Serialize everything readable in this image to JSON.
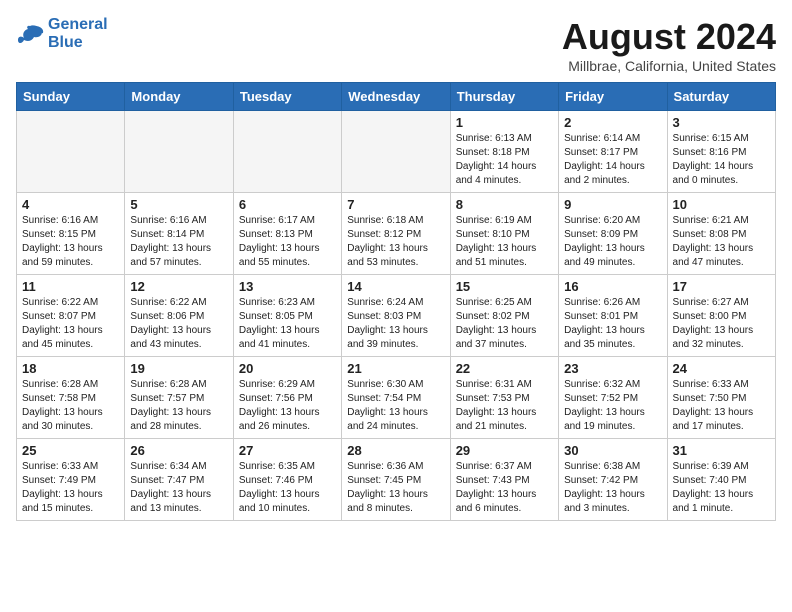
{
  "header": {
    "logo_line1": "General",
    "logo_line2": "Blue",
    "month_title": "August 2024",
    "location": "Millbrae, California, United States"
  },
  "weekdays": [
    "Sunday",
    "Monday",
    "Tuesday",
    "Wednesday",
    "Thursday",
    "Friday",
    "Saturday"
  ],
  "weeks": [
    [
      {
        "day": "",
        "info": ""
      },
      {
        "day": "",
        "info": ""
      },
      {
        "day": "",
        "info": ""
      },
      {
        "day": "",
        "info": ""
      },
      {
        "day": "1",
        "info": "Sunrise: 6:13 AM\nSunset: 8:18 PM\nDaylight: 14 hours\nand 4 minutes."
      },
      {
        "day": "2",
        "info": "Sunrise: 6:14 AM\nSunset: 8:17 PM\nDaylight: 14 hours\nand 2 minutes."
      },
      {
        "day": "3",
        "info": "Sunrise: 6:15 AM\nSunset: 8:16 PM\nDaylight: 14 hours\nand 0 minutes."
      }
    ],
    [
      {
        "day": "4",
        "info": "Sunrise: 6:16 AM\nSunset: 8:15 PM\nDaylight: 13 hours\nand 59 minutes."
      },
      {
        "day": "5",
        "info": "Sunrise: 6:16 AM\nSunset: 8:14 PM\nDaylight: 13 hours\nand 57 minutes."
      },
      {
        "day": "6",
        "info": "Sunrise: 6:17 AM\nSunset: 8:13 PM\nDaylight: 13 hours\nand 55 minutes."
      },
      {
        "day": "7",
        "info": "Sunrise: 6:18 AM\nSunset: 8:12 PM\nDaylight: 13 hours\nand 53 minutes."
      },
      {
        "day": "8",
        "info": "Sunrise: 6:19 AM\nSunset: 8:10 PM\nDaylight: 13 hours\nand 51 minutes."
      },
      {
        "day": "9",
        "info": "Sunrise: 6:20 AM\nSunset: 8:09 PM\nDaylight: 13 hours\nand 49 minutes."
      },
      {
        "day": "10",
        "info": "Sunrise: 6:21 AM\nSunset: 8:08 PM\nDaylight: 13 hours\nand 47 minutes."
      }
    ],
    [
      {
        "day": "11",
        "info": "Sunrise: 6:22 AM\nSunset: 8:07 PM\nDaylight: 13 hours\nand 45 minutes."
      },
      {
        "day": "12",
        "info": "Sunrise: 6:22 AM\nSunset: 8:06 PM\nDaylight: 13 hours\nand 43 minutes."
      },
      {
        "day": "13",
        "info": "Sunrise: 6:23 AM\nSunset: 8:05 PM\nDaylight: 13 hours\nand 41 minutes."
      },
      {
        "day": "14",
        "info": "Sunrise: 6:24 AM\nSunset: 8:03 PM\nDaylight: 13 hours\nand 39 minutes."
      },
      {
        "day": "15",
        "info": "Sunrise: 6:25 AM\nSunset: 8:02 PM\nDaylight: 13 hours\nand 37 minutes."
      },
      {
        "day": "16",
        "info": "Sunrise: 6:26 AM\nSunset: 8:01 PM\nDaylight: 13 hours\nand 35 minutes."
      },
      {
        "day": "17",
        "info": "Sunrise: 6:27 AM\nSunset: 8:00 PM\nDaylight: 13 hours\nand 32 minutes."
      }
    ],
    [
      {
        "day": "18",
        "info": "Sunrise: 6:28 AM\nSunset: 7:58 PM\nDaylight: 13 hours\nand 30 minutes."
      },
      {
        "day": "19",
        "info": "Sunrise: 6:28 AM\nSunset: 7:57 PM\nDaylight: 13 hours\nand 28 minutes."
      },
      {
        "day": "20",
        "info": "Sunrise: 6:29 AM\nSunset: 7:56 PM\nDaylight: 13 hours\nand 26 minutes."
      },
      {
        "day": "21",
        "info": "Sunrise: 6:30 AM\nSunset: 7:54 PM\nDaylight: 13 hours\nand 24 minutes."
      },
      {
        "day": "22",
        "info": "Sunrise: 6:31 AM\nSunset: 7:53 PM\nDaylight: 13 hours\nand 21 minutes."
      },
      {
        "day": "23",
        "info": "Sunrise: 6:32 AM\nSunset: 7:52 PM\nDaylight: 13 hours\nand 19 minutes."
      },
      {
        "day": "24",
        "info": "Sunrise: 6:33 AM\nSunset: 7:50 PM\nDaylight: 13 hours\nand 17 minutes."
      }
    ],
    [
      {
        "day": "25",
        "info": "Sunrise: 6:33 AM\nSunset: 7:49 PM\nDaylight: 13 hours\nand 15 minutes."
      },
      {
        "day": "26",
        "info": "Sunrise: 6:34 AM\nSunset: 7:47 PM\nDaylight: 13 hours\nand 13 minutes."
      },
      {
        "day": "27",
        "info": "Sunrise: 6:35 AM\nSunset: 7:46 PM\nDaylight: 13 hours\nand 10 minutes."
      },
      {
        "day": "28",
        "info": "Sunrise: 6:36 AM\nSunset: 7:45 PM\nDaylight: 13 hours\nand 8 minutes."
      },
      {
        "day": "29",
        "info": "Sunrise: 6:37 AM\nSunset: 7:43 PM\nDaylight: 13 hours\nand 6 minutes."
      },
      {
        "day": "30",
        "info": "Sunrise: 6:38 AM\nSunset: 7:42 PM\nDaylight: 13 hours\nand 3 minutes."
      },
      {
        "day": "31",
        "info": "Sunrise: 6:39 AM\nSunset: 7:40 PM\nDaylight: 13 hours\nand 1 minute."
      }
    ]
  ]
}
